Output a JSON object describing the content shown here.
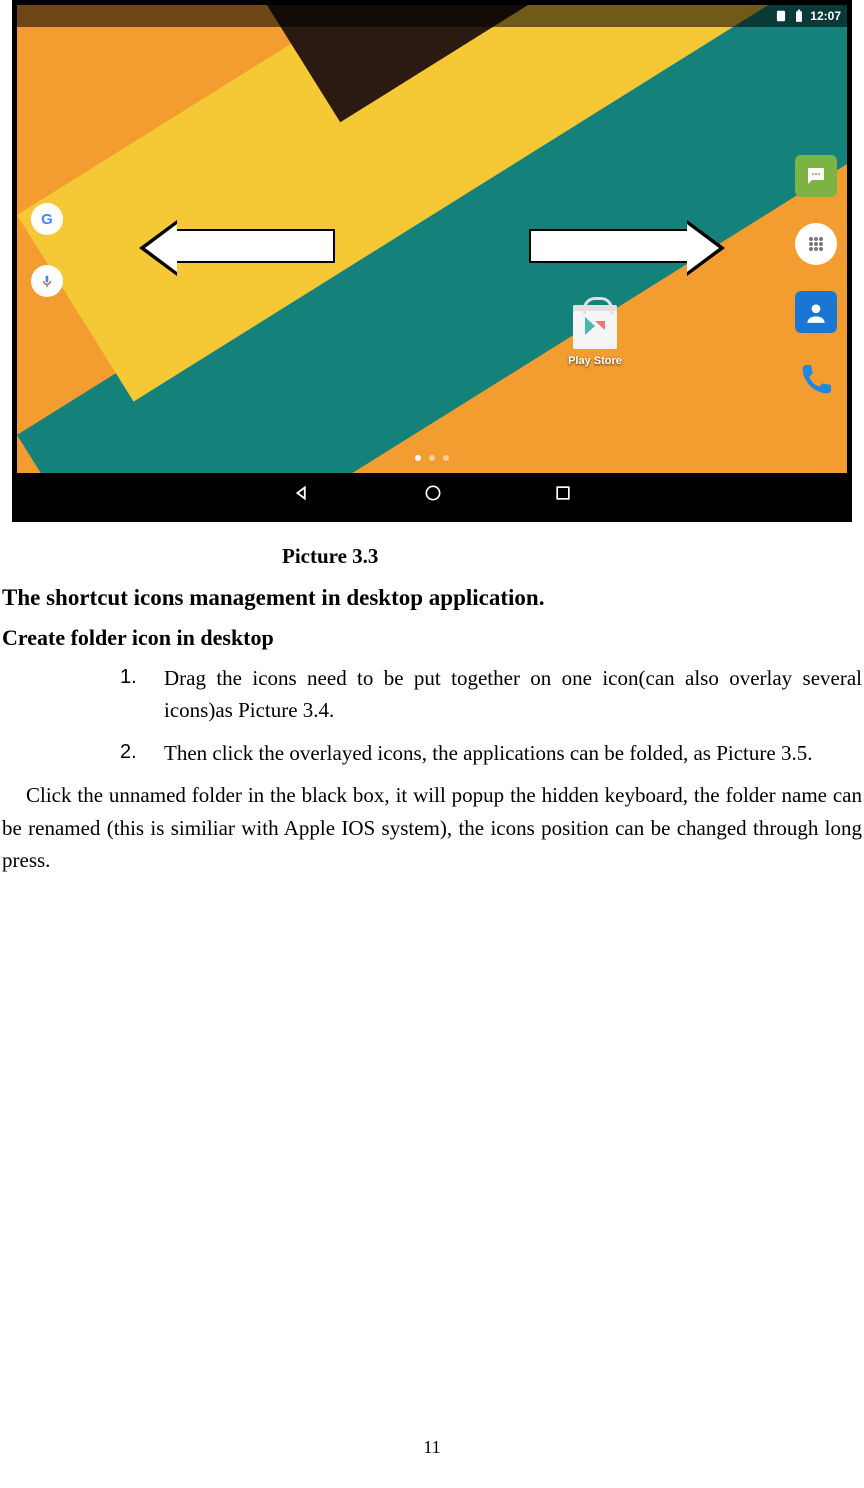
{
  "screenshot": {
    "statusbar": {
      "time": "12:07"
    },
    "playstore_label": "Play Store",
    "dock": {
      "messages": "Messages",
      "apps": "Apps",
      "contacts": "Contacts",
      "phone": "Phone"
    }
  },
  "caption": "Picture 3.3",
  "heading1": "The shortcut icons management in desktop application.",
  "heading2": "Create folder icon in desktop",
  "list": {
    "n1": "1.",
    "item1": "Drag the icons need to be put together on one icon(can also overlay several icons)as Picture 3.4.",
    "n2": "2.",
    "item2": "Then click the overlayed icons, the applications can be folded, as Picture 3.5."
  },
  "paragraph": "Click the unnamed folder in the black box, it will popup the hidden keyboard, the folder name can be renamed (this is similiar with Apple IOS system), the icons position can be changed through long press.",
  "page_number": "11"
}
